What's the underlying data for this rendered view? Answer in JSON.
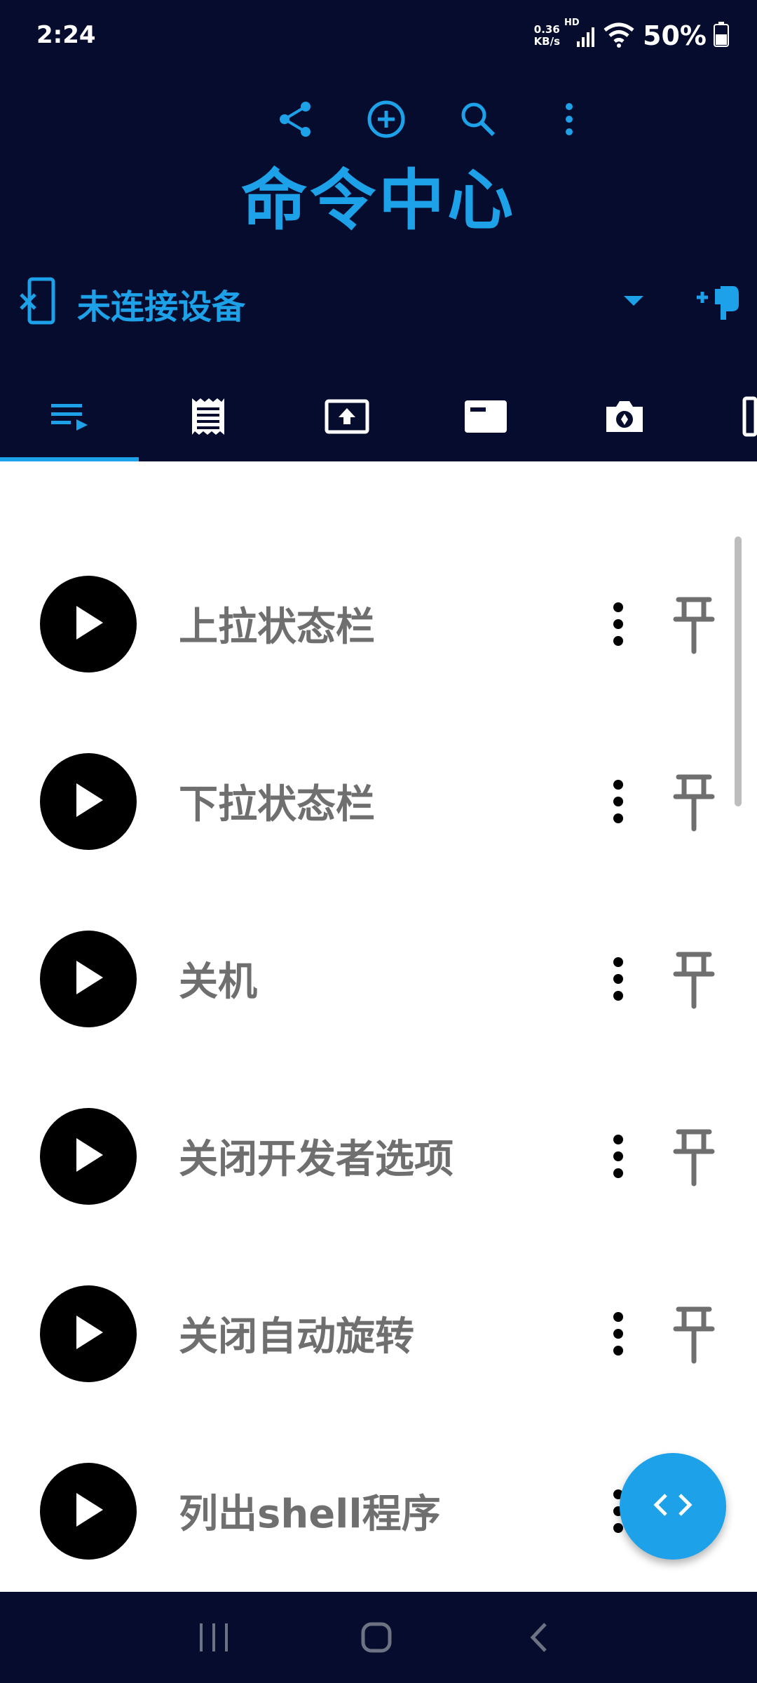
{
  "status_bar": {
    "time": "2:24",
    "net_speed_value": "0.36",
    "net_speed_unit": "KB/s",
    "network_type": "HD",
    "battery": "50%"
  },
  "app_bar": {
    "title": "命令中心",
    "actions": [
      "share-icon",
      "add-circle-icon",
      "search-icon",
      "more-vert-icon"
    ]
  },
  "device": {
    "label": "未连接设备",
    "icons": [
      "device-disconnected-icon",
      "dropdown-arrow-icon",
      "add-connection-icon"
    ]
  },
  "tabs": [
    "command-list-icon",
    "script-icon",
    "upload-icon",
    "window-icon",
    "screenshot-icon",
    "more-tab-icon"
  ],
  "active_tab_index": 0,
  "commands": [
    {
      "label": "上拉状态栏"
    },
    {
      "label": "下拉状态栏"
    },
    {
      "label": "关机"
    },
    {
      "label": "关闭开发者选项"
    },
    {
      "label": "关闭自动旋转"
    },
    {
      "label": "列出shell程序"
    }
  ],
  "fab_icon": "code-icon",
  "colors": {
    "header_bg": "#050c2e",
    "accent": "#1da1e8",
    "label_gray": "#6f6f6f"
  }
}
